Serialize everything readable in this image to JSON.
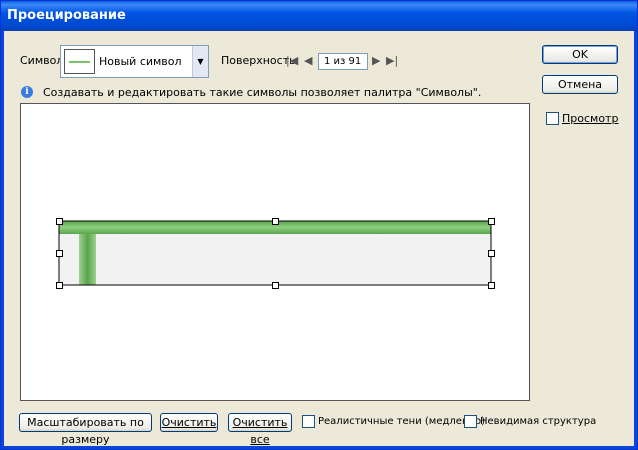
{
  "window": {
    "title": "Проецирование"
  },
  "symbol": {
    "label": "Символ:",
    "name": "Новый символ",
    "swatch_color": "#7ac36a"
  },
  "surface": {
    "label": "Поверхность:",
    "value": "1 из 91"
  },
  "info": {
    "text": "Создавать и редактировать такие символы позволяет палитра \"Символы\"."
  },
  "buttons": {
    "ok": "OK",
    "cancel": "Отмена"
  },
  "preview": {
    "label": "Просмотр",
    "checked": false
  },
  "bottom": {
    "scale": "Масштабировать по размеру",
    "clear": "Очистить",
    "clear_all": "Очистить все",
    "shading_label": "Реалистичные тени (медленно)",
    "invisible_label": "Невидимая структура"
  },
  "colors": {
    "title_blue": "#0054e3",
    "dialog_bg": "#ece9d8",
    "line_green": "#7ac36a",
    "panel_fill": "#f2f2f2"
  }
}
